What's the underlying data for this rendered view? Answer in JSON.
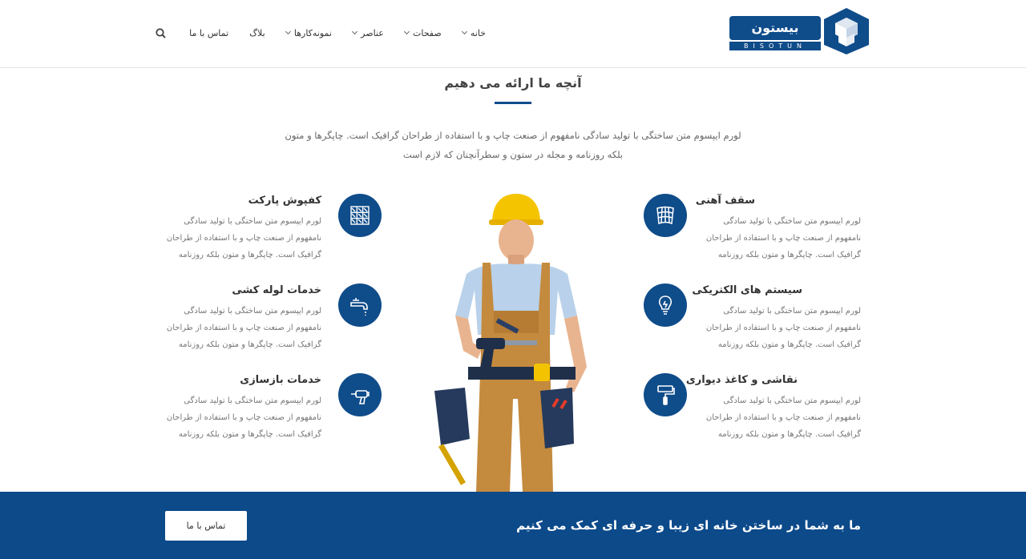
{
  "brand": {
    "logo_text": "بیستون",
    "logo_sub": "BISOTUN",
    "color": "#0f4c8a"
  },
  "nav": {
    "items": [
      {
        "label": "خانه",
        "has_dropdown": true
      },
      {
        "label": "صفحات",
        "has_dropdown": true
      },
      {
        "label": "عناصر",
        "has_dropdown": true
      },
      {
        "label": "نمونه‌کارها",
        "has_dropdown": true
      },
      {
        "label": "بلاگ",
        "has_dropdown": false
      },
      {
        "label": "تماس با ما",
        "has_dropdown": false
      }
    ],
    "search_icon": "search-icon"
  },
  "section": {
    "title": "آنچه ما ارائه می دهیم",
    "desc_line1": "لورم ایپسوم متن ساختگی با تولید سادگی نامفهوم از صنعت چاپ و با استفاده از طراحان گرافیک است. چاپگرها و متون",
    "desc_line2": "بلکه روزنامه و مجله در ستون و سطرآنچنان که لازم است"
  },
  "services": [
    {
      "title": "سقف آهنی",
      "icon": "roof-tiles-icon",
      "line1": "لورم ایپسوم متن ساختگی با تولید سادگی",
      "line2": "نامفهوم از صنعت چاپ و با استفاده از طراحان",
      "line3": "گرافیک است. چاپگرها و متون بلکه روزنامه"
    },
    {
      "title": "سیستم های الکتریکی",
      "icon": "lightbulb-icon",
      "line1": "لورم ایپسوم متن ساختگی با تولید سادگی",
      "line2": "نامفهوم از صنعت چاپ و با استفاده از طراحان",
      "line3": "گرافیک است. چاپگرها و متون بلکه روزنامه"
    },
    {
      "title": "نقاشی و کاغذ دیواری",
      "icon": "paint-roller-icon",
      "line1": "لورم ایپسوم متن ساختگی با تولید سادگی",
      "line2": "نامفهوم از صنعت چاپ و با استفاده از طراحان",
      "line3": "گرافیک است. چاپگرها و متون بلکه روزنامه"
    },
    {
      "title": "کفپوش پارکت",
      "icon": "parquet-grid-icon",
      "line1": "لورم ایپسوم متن ساختگی با تولید سادگی",
      "line2": "نامفهوم از صنعت چاپ و با استفاده از طراحان",
      "line3": "گرافیک است. چاپگرها و متون بلکه روزنامه"
    },
    {
      "title": "خدمات لوله کشی",
      "icon": "faucet-icon",
      "line1": "لورم ایپسوم متن ساختگی با تولید سادگی",
      "line2": "نامفهوم از صنعت چاپ و با استفاده از طراحان",
      "line3": "گرافیک است. چاپگرها و متون بلکه روزنامه"
    },
    {
      "title": "خدمات بازسازی",
      "icon": "drill-icon",
      "line1": "لورم ایپسوم متن ساختگی با تولید سادگی",
      "line2": "نامفهوم از صنعت چاپ و با استفاده از طراحان",
      "line3": "گرافیک است. چاپگرها و متون بلکه روزنامه"
    }
  ],
  "band": {
    "text": "ما به شما در ساختن خانه ای زیبا و حرفه ای کمک می کنیم",
    "button_label": "تماس با ما"
  }
}
